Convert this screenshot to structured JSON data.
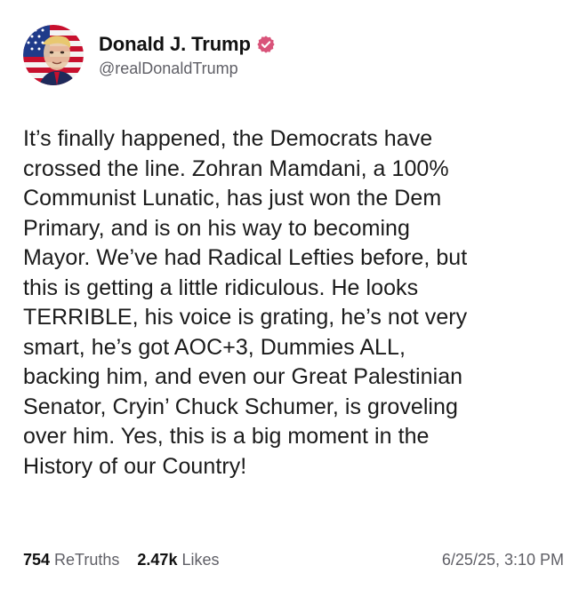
{
  "author": {
    "display_name": "Donald J. Trump",
    "handle": "@realDonaldTrump",
    "verified_icon": "verified-badge-icon",
    "verified_color": "#d9547a"
  },
  "post": {
    "lines": [
      "It’s finally happened, the Democrats have",
      "crossed the line. Zohran Mamdani, a 100%",
      "Communist Lunatic, has just won the Dem",
      "Primary, and is on his way to becoming",
      "Mayor. We’ve had Radical Lefties before, but",
      "this is getting a little ridiculous. He looks",
      "TERRIBLE, his voice is grating, he’s not very",
      "smart, he’s got AOC+3, Dummies ALL,",
      "backing him, and even our Great Palestinian",
      "Senator, Cryin’ Chuck Schumer, is groveling",
      "over him. Yes, this is a big moment in the",
      "History of our Country!"
    ]
  },
  "stats": {
    "retruths_count": "754",
    "retruths_label": "ReTruths",
    "likes_count": "2.47k",
    "likes_label": "Likes",
    "timestamp": "6/25/25, 3:10 PM"
  }
}
